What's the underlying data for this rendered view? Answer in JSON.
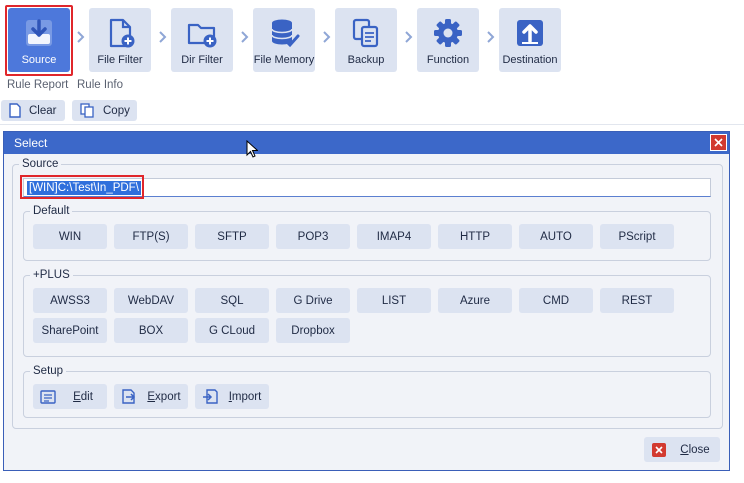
{
  "toolbar": {
    "buttons": [
      {
        "label": "Source",
        "icon": "download-arrow-icon"
      },
      {
        "label": "File Filter",
        "icon": "file-add-icon"
      },
      {
        "label": "Dir Filter",
        "icon": "folder-add-icon"
      },
      {
        "label": "File Memory",
        "icon": "database-check-icon"
      },
      {
        "label": "Backup",
        "icon": "copy-documents-icon"
      },
      {
        "label": "Function",
        "icon": "gear-icon"
      },
      {
        "label": "Destination",
        "icon": "upload-arrow-icon"
      }
    ],
    "group_labels": [
      "Rule Report",
      "Rule Info"
    ],
    "clear_label": "Clear",
    "copy_label": "Copy",
    "accent": "#4d78db",
    "highlight": "#e0262b"
  },
  "dialog": {
    "title": "Select",
    "source_legend": "Source",
    "source_value": "[WIN]C:\\Test\\In_PDF\\",
    "default_legend": "Default",
    "default_buttons": [
      "WIN",
      "FTP(S)",
      "SFTP",
      "POP3",
      "IMAP4",
      "HTTP",
      "AUTO",
      "PScript"
    ],
    "plus_legend": "+PLUS",
    "plus_buttons_row1": [
      "AWSS3",
      "WebDAV",
      "SQL",
      "G Drive",
      "LIST",
      "Azure",
      "CMD",
      "REST"
    ],
    "plus_buttons_row2": [
      "SharePoint",
      "BOX",
      "G CLoud",
      "Dropbox"
    ],
    "setup_legend": "Setup",
    "edit_label": "Edit",
    "export_label": "Export",
    "import_label": "Import",
    "close_label": "Close",
    "title_color": "#3c68c9"
  }
}
